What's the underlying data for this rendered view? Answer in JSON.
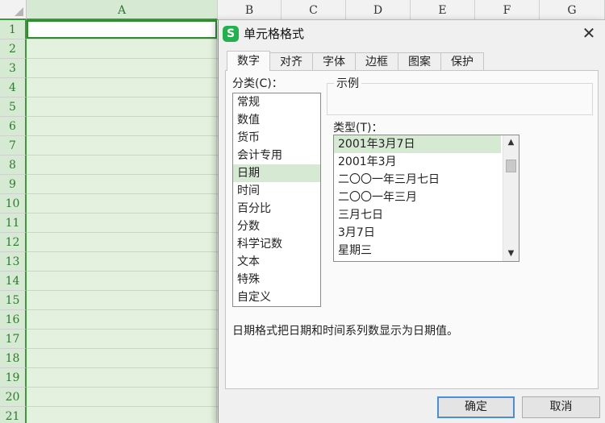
{
  "sheet": {
    "columns": [
      "A",
      "B",
      "C",
      "D",
      "E",
      "F",
      "G"
    ],
    "rows": [
      "1",
      "2",
      "3",
      "4",
      "5",
      "6",
      "7",
      "8",
      "9",
      "10",
      "11",
      "12",
      "13",
      "14",
      "15",
      "16",
      "17",
      "18",
      "19",
      "20",
      "21"
    ]
  },
  "dialog": {
    "app_icon": "S",
    "title": "单元格格式",
    "close_label": "✕",
    "tabs": [
      "数字",
      "对齐",
      "字体",
      "边框",
      "图案",
      "保护"
    ],
    "category_label": "分类(C)：",
    "categories": [
      "常规",
      "数值",
      "货币",
      "会计专用",
      "日期",
      "时间",
      "百分比",
      "分数",
      "科学记数",
      "文本",
      "特殊",
      "自定义"
    ],
    "selected_category": "日期",
    "sample_label": "示例",
    "type_label": "类型(T)：",
    "types": [
      "2001年3月7日",
      "2001年3月",
      "二〇〇一年三月七日",
      "二〇〇一年三月",
      "三月七日",
      "3月7日",
      "星期三"
    ],
    "selected_type": "2001年3月7日",
    "scroll_up": "▲",
    "scroll_down": "▼",
    "description": "日期格式把日期和时间系列数显示为日期值。",
    "ok_label": "确定",
    "cancel_label": "取消"
  },
  "colors": {
    "accent_green": "#3a9a3a",
    "selection_fill": "#d6e9d3",
    "ok_border": "#4a8fd6"
  }
}
